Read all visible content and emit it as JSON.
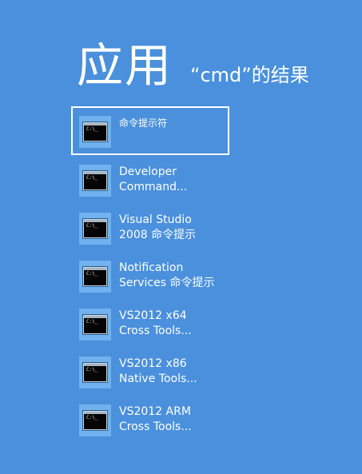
{
  "header": {
    "title": "应用",
    "subtitle": "“cmd”的结果"
  },
  "results": [
    {
      "line1": "命令提示符",
      "line2": "",
      "icon": "command-prompt-icon",
      "selected": true
    },
    {
      "line1": "Developer",
      "line2": "Command...",
      "icon": "command-prompt-icon",
      "selected": false
    },
    {
      "line1": "Visual Studio",
      "line2": "2008 命令提示",
      "icon": "command-prompt-icon",
      "selected": false
    },
    {
      "line1": "Notification",
      "line2": "Services 命令提示",
      "icon": "command-prompt-icon",
      "selected": false
    },
    {
      "line1": "VS2012 x64",
      "line2": "Cross Tools...",
      "icon": "command-prompt-icon",
      "selected": false
    },
    {
      "line1": "VS2012 x86",
      "line2": "Native Tools...",
      "icon": "command-prompt-icon",
      "selected": false
    },
    {
      "line1": "VS2012 ARM",
      "line2": "Cross Tools...",
      "icon": "command-prompt-icon",
      "selected": false
    }
  ],
  "icon_text": "C:\\_",
  "colors": {
    "background": "#4a90dc",
    "tile": "#6fb2ee",
    "text": "#ffffff",
    "selection_border": "#ffffff"
  }
}
